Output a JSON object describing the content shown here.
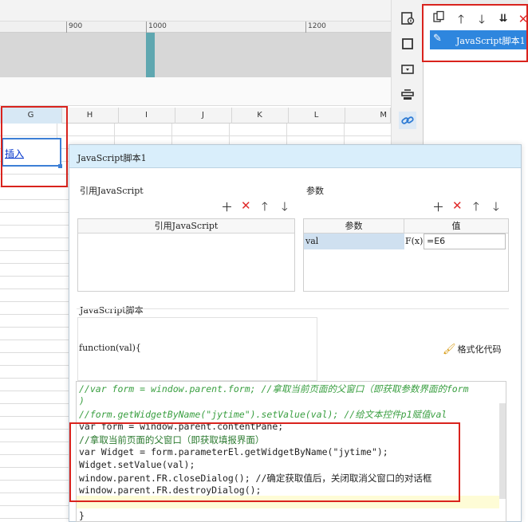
{
  "ruler": {
    "labels": [
      "900",
      "1000",
      "1200"
    ]
  },
  "sheet": {
    "columns": [
      "G",
      "H",
      "I",
      "J",
      "K",
      "L",
      "M"
    ],
    "selected_cell_text": "插入"
  },
  "right_panel": {
    "item_label": "JavaScript脚本1"
  },
  "dialog": {
    "title": "JavaScript脚本1",
    "ref_section": "引用JavaScript",
    "ref_table_header": "引用JavaScript",
    "param_section": "参数",
    "param_headers": [
      "参数",
      "值"
    ],
    "param_rows": [
      {
        "name": "val",
        "fx": "F(x)",
        "value": "=E6"
      }
    ],
    "script_section": "JavaScript脚本",
    "function_header": "function(val){",
    "format_button": "格式化代码",
    "code_lines": [
      "//var form = window.parent.form; //拿取当前页面的父窗口（即获取参数界面的form",
      ")",
      "//form.getWidgetByName(\"jytime\").setValue(val); //给文本控件p1赋值val",
      "var form = window.parent.contentPane;",
      "//拿取当前页面的父窗口（即获取填报界面）",
      "var Widget = form.parameterEl.getWidgetByName(\"jytime\");",
      "Widget.setValue(val);",
      "window.parent.FR.closeDialog(); //确定获取值后，关闭取消父窗口的对话框",
      "window.parent.FR.destroyDialog();",
      "",
      "}"
    ]
  },
  "colors": {
    "accent": "#2e86de",
    "highlight_box": "#d9231d",
    "title_bar": "#d9eefb"
  }
}
